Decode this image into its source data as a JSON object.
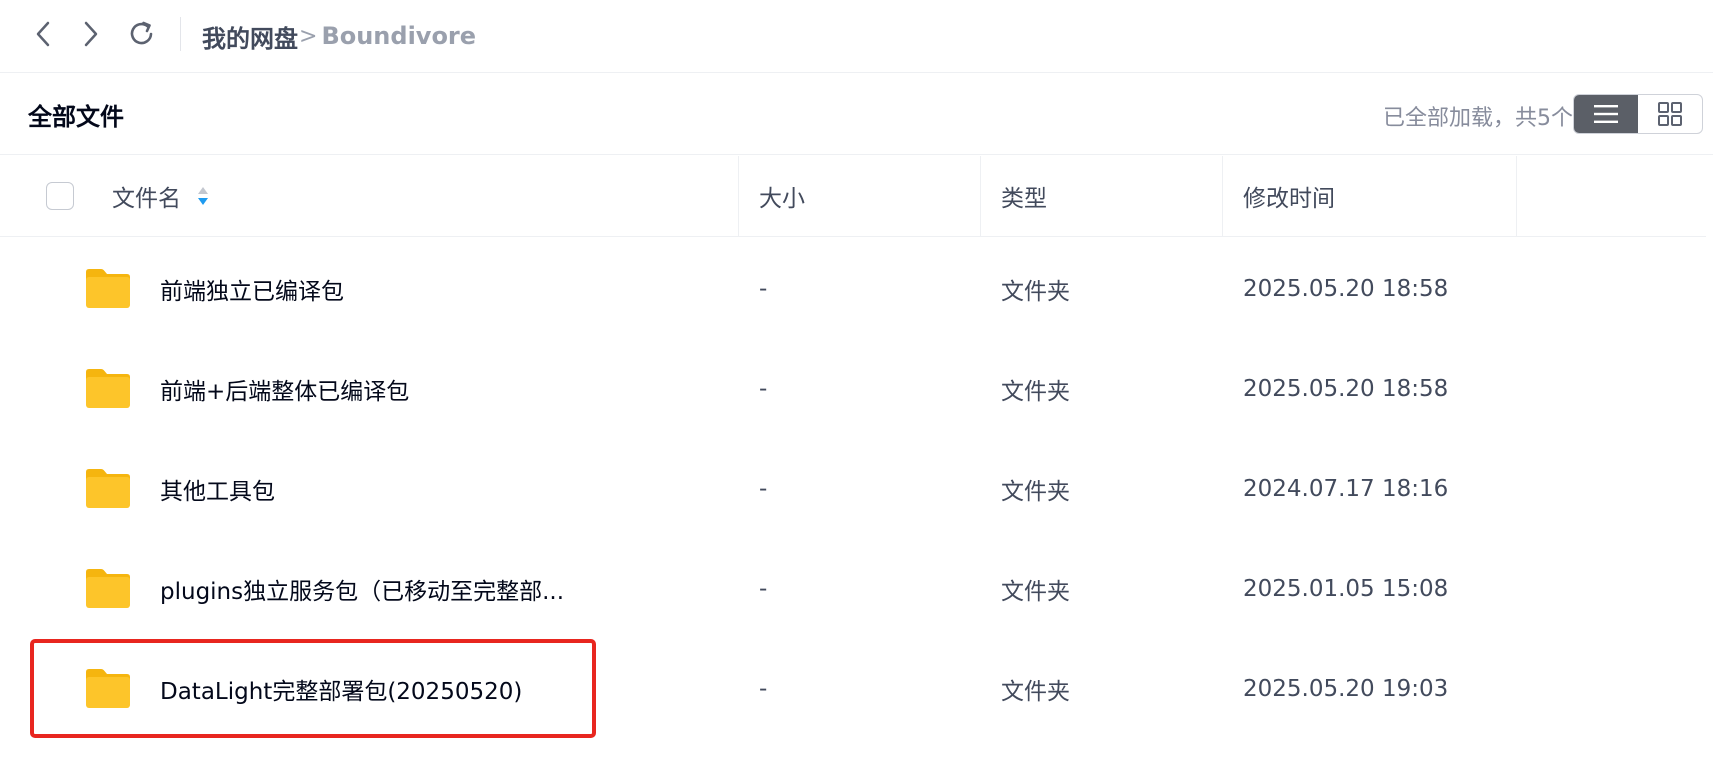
{
  "nav": {
    "back_icon": "chevron-left-icon",
    "forward_icon": "chevron-right-icon",
    "refresh_icon": "refresh-icon"
  },
  "breadcrumb": {
    "root": "我的网盘",
    "separator": ">",
    "current": "Boundivore"
  },
  "header": {
    "title": "全部文件",
    "count_text": "已全部加载，共5个",
    "view_modes": [
      "list-view-icon",
      "grid-view-icon"
    ],
    "active_view": "list"
  },
  "table": {
    "columns": {
      "name": "文件名",
      "size": "大小",
      "type": "类型",
      "modified": "修改时间"
    },
    "rows": [
      {
        "name": "前端独立已编译包",
        "size": "-",
        "type": "文件夹",
        "modified": "2025.05.20 18:58"
      },
      {
        "name": "前端+后端整体已编译包",
        "size": "-",
        "type": "文件夹",
        "modified": "2025.05.20 18:58"
      },
      {
        "name": "其他工具包",
        "size": "-",
        "type": "文件夹",
        "modified": "2024.07.17 18:16"
      },
      {
        "name": "plugins独立服务包（已移动至完整部...",
        "size": "-",
        "type": "文件夹",
        "modified": "2025.01.05 15:08"
      },
      {
        "name": "DataLight完整部署包(20250520)",
        "size": "-",
        "type": "文件夹",
        "modified": "2025.05.20 19:03"
      }
    ]
  },
  "colors": {
    "highlight": "#e8261f",
    "folder": "#fdc52a",
    "sort_active": "#1e9bf0"
  }
}
